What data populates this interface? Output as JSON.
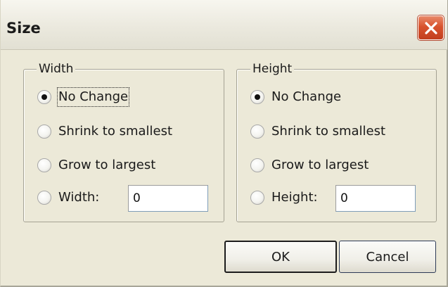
{
  "window": {
    "title": "Size"
  },
  "width_group": {
    "title": "Width",
    "options": [
      {
        "label": "No Change",
        "checked": true
      },
      {
        "label": "Shrink to smallest",
        "checked": false
      },
      {
        "label": "Grow to largest",
        "checked": false
      },
      {
        "label": "Width:",
        "checked": false
      }
    ],
    "value": "0"
  },
  "height_group": {
    "title": "Height",
    "options": [
      {
        "label": "No Change",
        "checked": true
      },
      {
        "label": "Shrink to smallest",
        "checked": false
      },
      {
        "label": "Grow to largest",
        "checked": false
      },
      {
        "label": "Height:",
        "checked": false
      }
    ],
    "value": "0"
  },
  "buttons": {
    "ok": "OK",
    "cancel": "Cancel"
  }
}
